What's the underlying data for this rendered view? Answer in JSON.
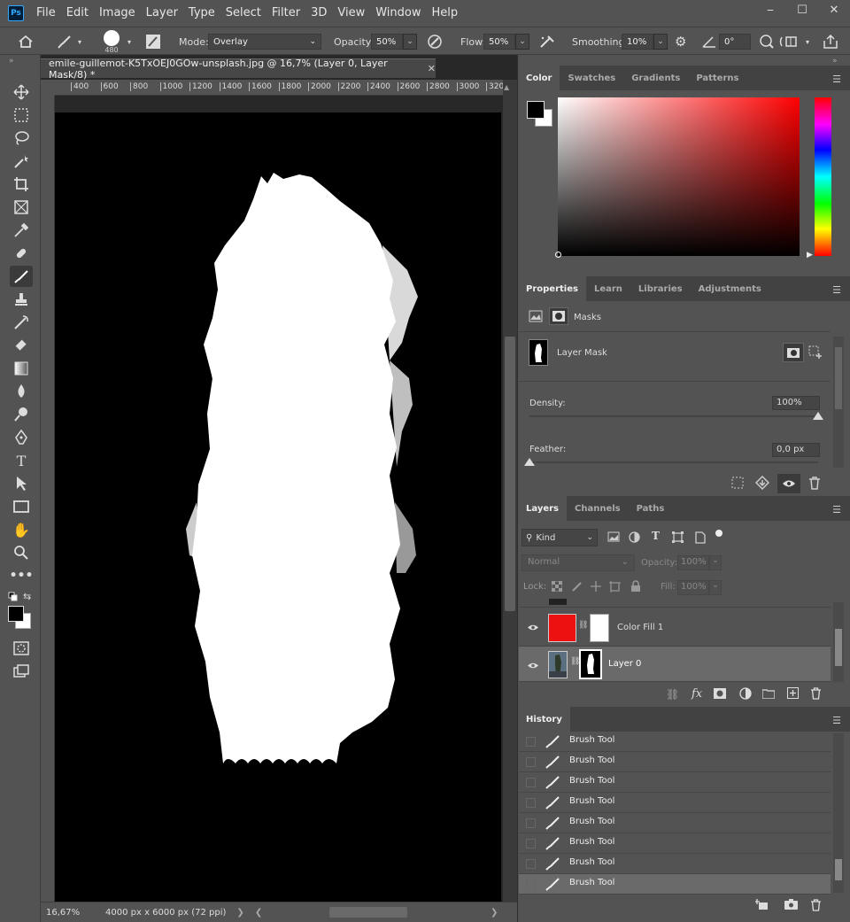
{
  "menu": {
    "logo": "Ps",
    "items": [
      "File",
      "Edit",
      "Image",
      "Layer",
      "Type",
      "Select",
      "Filter",
      "3D",
      "View",
      "Window",
      "Help"
    ],
    "win": [
      "⎯",
      "☐",
      "✕"
    ]
  },
  "options": {
    "brush_size": "480",
    "mode_label": "Mode:",
    "mode_value": "Overlay",
    "opacity_label": "Opacity:",
    "opacity_value": "50%",
    "flow_label": "Flow:",
    "flow_value": "50%",
    "smoothing_label": "Smoothing:",
    "smoothing_value": "10%",
    "angle_value": "0°"
  },
  "document": {
    "tab_title": "emile-guillemot-K5TxOEJ0GOw-unsplash.jpg @ 16,7% (Layer 0, Layer Mask/8) *",
    "ruler_ticks": [
      "400",
      "600",
      "800",
      "1000",
      "1200",
      "1400",
      "1600",
      "1800",
      "2000",
      "2200",
      "2400",
      "2600",
      "2800",
      "3000",
      "320"
    ],
    "zoom": "16,67%",
    "doc_info": "4000 px x 6000 px (72 ppi)"
  },
  "color_panel": {
    "tabs": [
      "Color",
      "Swatches",
      "Gradients",
      "Patterns"
    ],
    "fg": "#000000",
    "bg": "#ffffff",
    "hue": "#ff0000"
  },
  "properties": {
    "tabs": [
      "Properties",
      "Learn",
      "Libraries",
      "Adjustments"
    ],
    "masks_label": "Masks",
    "layer_mask_label": "Layer Mask",
    "density_label": "Density:",
    "density_value": "100%",
    "density_level": 1.0,
    "feather_label": "Feather:",
    "feather_value": "0,0 px",
    "feather_level": 0.0
  },
  "layers": {
    "tabs": [
      "Layers",
      "Channels",
      "Paths"
    ],
    "filter_kind": "Kind",
    "blend": "Normal",
    "opacity_label": "Opacity:",
    "opacity_value": "100%",
    "lock_label": "Lock:",
    "fill_label": "Fill:",
    "fill_value": "100%",
    "items": [
      {
        "name": "Color Fill 1",
        "color": "#ee1111"
      },
      {
        "name": "Layer 0",
        "color": "#5a7080"
      }
    ]
  },
  "history": {
    "tab": "History",
    "items": [
      "Brush Tool",
      "Brush Tool",
      "Brush Tool",
      "Brush Tool",
      "Brush Tool",
      "Brush Tool",
      "Brush Tool",
      "Brush Tool"
    ]
  }
}
